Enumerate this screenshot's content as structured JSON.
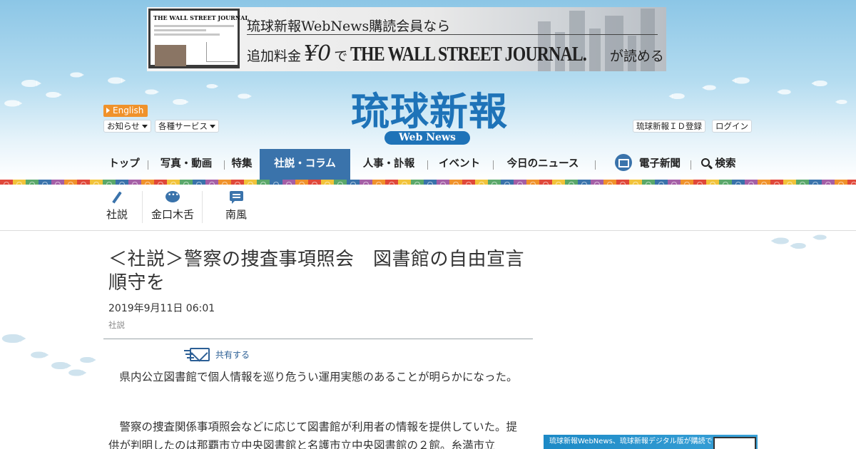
{
  "ad_banner": {
    "laptop_title": "THE WALL STREET JOURNAL",
    "line1": "琉球新報WebNews購読会員なら",
    "line2_prefix": "追加料金",
    "price": "¥0",
    "line2_de": "で",
    "wsj": "THE WALL STREET JOURNAL.",
    "line2_suffix": "が読める"
  },
  "logo": {
    "title": "琉球新報",
    "badge": "Web News"
  },
  "header": {
    "english_label": "English",
    "notice_label": "お知らせ",
    "services_label": "各種サービス",
    "id_register_label": "琉球新報ＩＤ登録",
    "login_label": "ログイン"
  },
  "nav": {
    "items": [
      {
        "label": "トップ"
      },
      {
        "label": "写真・動画"
      },
      {
        "label": "特集"
      },
      {
        "label": "社説・コラム"
      },
      {
        "label": "人事・訃報"
      },
      {
        "label": "イベント"
      },
      {
        "label": "今日のニュース"
      },
      {
        "label": "電子新聞"
      },
      {
        "label": "検索"
      }
    ],
    "active_index": 3
  },
  "subnav": {
    "items": [
      {
        "label": "社説",
        "icon": "pen-icon"
      },
      {
        "label": "金口木舌",
        "icon": "speech-bubble-icon"
      },
      {
        "label": "南風",
        "icon": "comment-icon"
      }
    ]
  },
  "article": {
    "title": "＜社説＞警察の捜査事項照会　図書館の自由宣言順守を",
    "date": "2019年9月11日 06:01",
    "category": "社説",
    "share_label": "共有する",
    "paragraphs": [
      "　県内公立図書館で個人情報を巡り危うい運用実態のあることが明らかになった。",
      "　警察の捜査関係事項照会などに応じて図書館が利用者の情報を提供していた。提供が判明したのは那覇市立中央図書館と名護市立中央図書館の２館。糸満市立"
    ]
  },
  "side_ad": {
    "text": "琉球新報WebNews、琉球新報デジタル版が購読できる"
  },
  "colors": {
    "brand_blue": "#1e73b8",
    "nav_active": "#3a73ab",
    "english_orange": "#f0922b"
  }
}
